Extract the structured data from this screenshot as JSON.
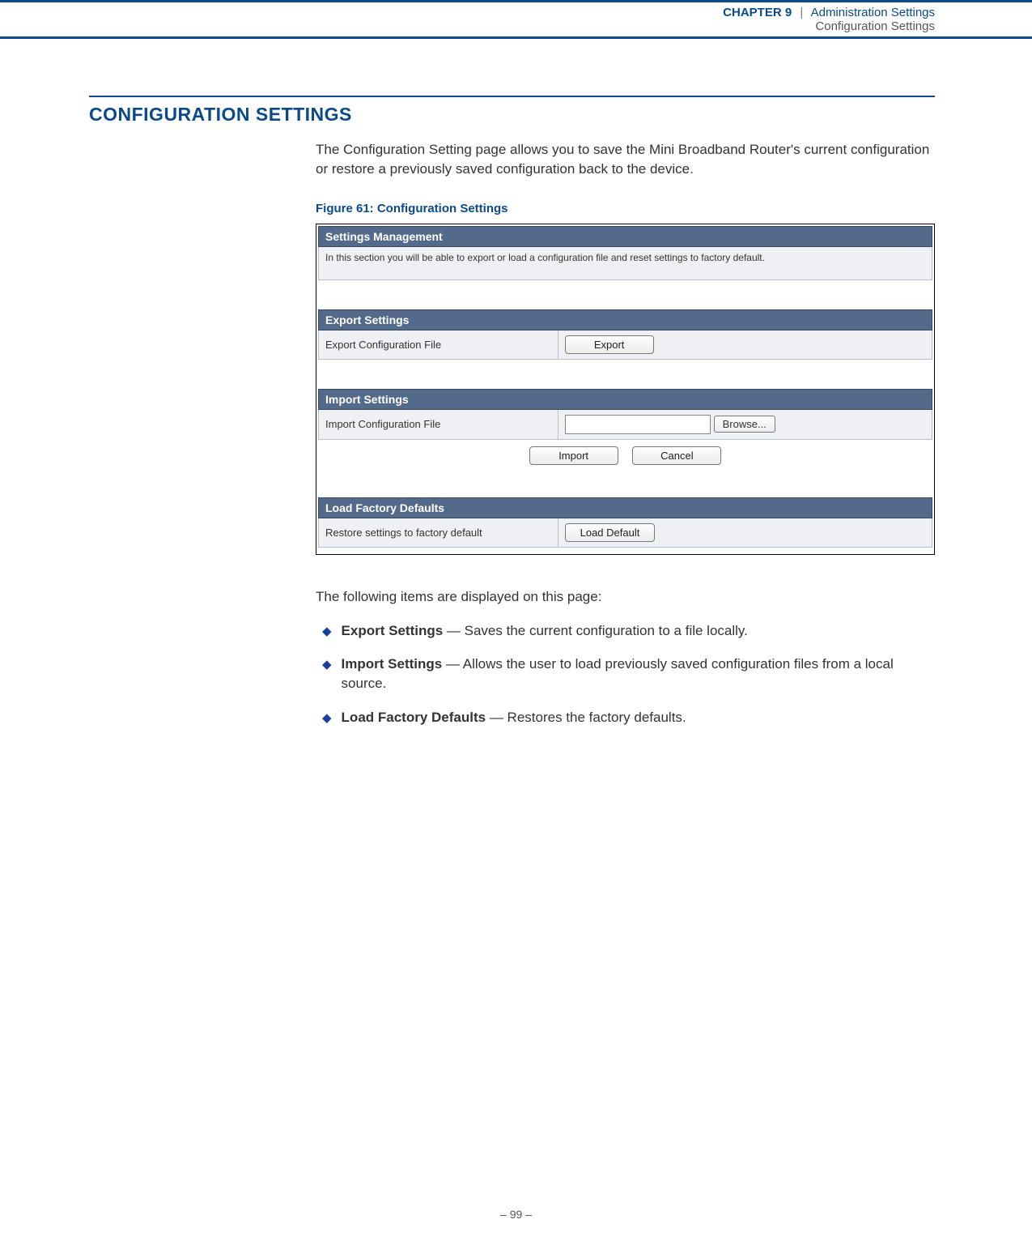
{
  "header": {
    "chapter": "CHAPTER 9",
    "separator": "|",
    "breadcrumb1": "Administration Settings",
    "breadcrumb2": "Configuration Settings"
  },
  "section": {
    "title": "CONFIGURATION SETTINGS",
    "intro": "The Configuration Setting page allows you to save the Mini Broadband Router's current configuration or restore a previously saved configuration back to the device."
  },
  "figure": {
    "caption": "Figure 61:  Configuration Settings"
  },
  "screenshot": {
    "mainHeader": "Settings Management",
    "mainDesc": "In this section you will be able to export or load a configuration file and reset settings to factory default.",
    "export": {
      "header": "Export Settings",
      "label": "Export Configuration File",
      "button": "Export"
    },
    "import": {
      "header": "Import Settings",
      "label": "Import Configuration File",
      "browse": "Browse...",
      "importBtn": "Import",
      "cancelBtn": "Cancel"
    },
    "factory": {
      "header": "Load Factory Defaults",
      "label": "Restore settings to factory default",
      "button": "Load Default"
    }
  },
  "below": {
    "intro": "The following items are displayed on this page:",
    "items": [
      {
        "term": "Export Settings",
        "desc": " — Saves the current configuration to a file locally."
      },
      {
        "term": "Import Settings",
        "desc": " — Allows the user to load previously saved configuration files from a local source."
      },
      {
        "term": "Load Factory Defaults",
        "desc": " — Restores the factory defaults."
      }
    ]
  },
  "footer": {
    "page": "–  99  –"
  }
}
